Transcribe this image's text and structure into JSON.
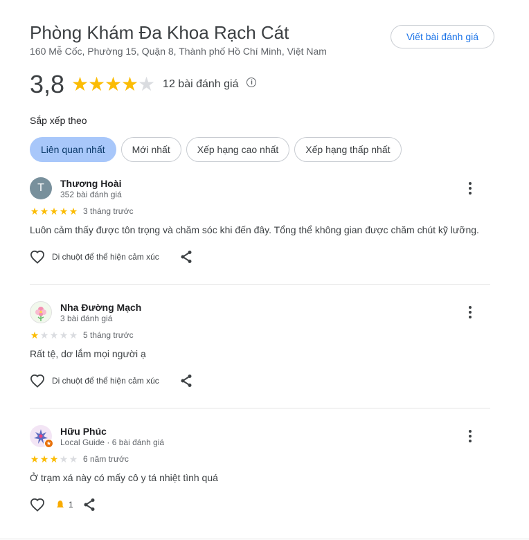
{
  "place": {
    "name": "Phòng Khám Đa Khoa Rạch Cát",
    "address": "160 Mễ Cốc, Phường 15, Quận 8, Thành phố Hồ Chí Minh, Việt Nam",
    "write_review_label": "Viết bài đánh giá"
  },
  "summary": {
    "rating": "3,8",
    "rating_value": 3.8,
    "review_count": "12 bài đánh giá",
    "info_icon": "info-icon"
  },
  "sort": {
    "label": "Sắp xếp theo",
    "options": [
      "Liên quan nhất",
      "Mới nhất",
      "Xếp hạng cao nhất",
      "Xếp hạng thấp nhất"
    ],
    "selected": "Liên quan nhất"
  },
  "colors": {
    "star_filled": "#fbbc04",
    "star_empty": "#dadce0",
    "accent": "#1a73e8",
    "chip_active": "#a8c7fa"
  },
  "reviews": [
    {
      "author": "Thương Hoài",
      "initial": "T",
      "meta": "352 bài đánh giá",
      "rating": 5,
      "time": "3 tháng trước",
      "text": "Luôn cảm thấy được tôn trọng và chăm sóc khi đến đây. Tổng thể không gian được chăm chút kỹ lưỡng.",
      "react_label": "Di chuột để thể hiện cảm xúc"
    },
    {
      "author": "Nha Đường Mạch",
      "meta": "3 bài đánh giá",
      "rating": 1,
      "time": "5 tháng trước",
      "text": "Rất tệ, dơ lắm mọi người ạ",
      "react_label": "Di chuột để thể hiện cảm xúc"
    },
    {
      "author": "Hữu Phúc",
      "meta": "Local Guide · 6 bài đánh giá",
      "rating": 3,
      "time": "6 năm trước",
      "text": "Ở trạm xá này có mấy cô y tá nhiệt tình quá",
      "reaction_count": "1"
    }
  ]
}
